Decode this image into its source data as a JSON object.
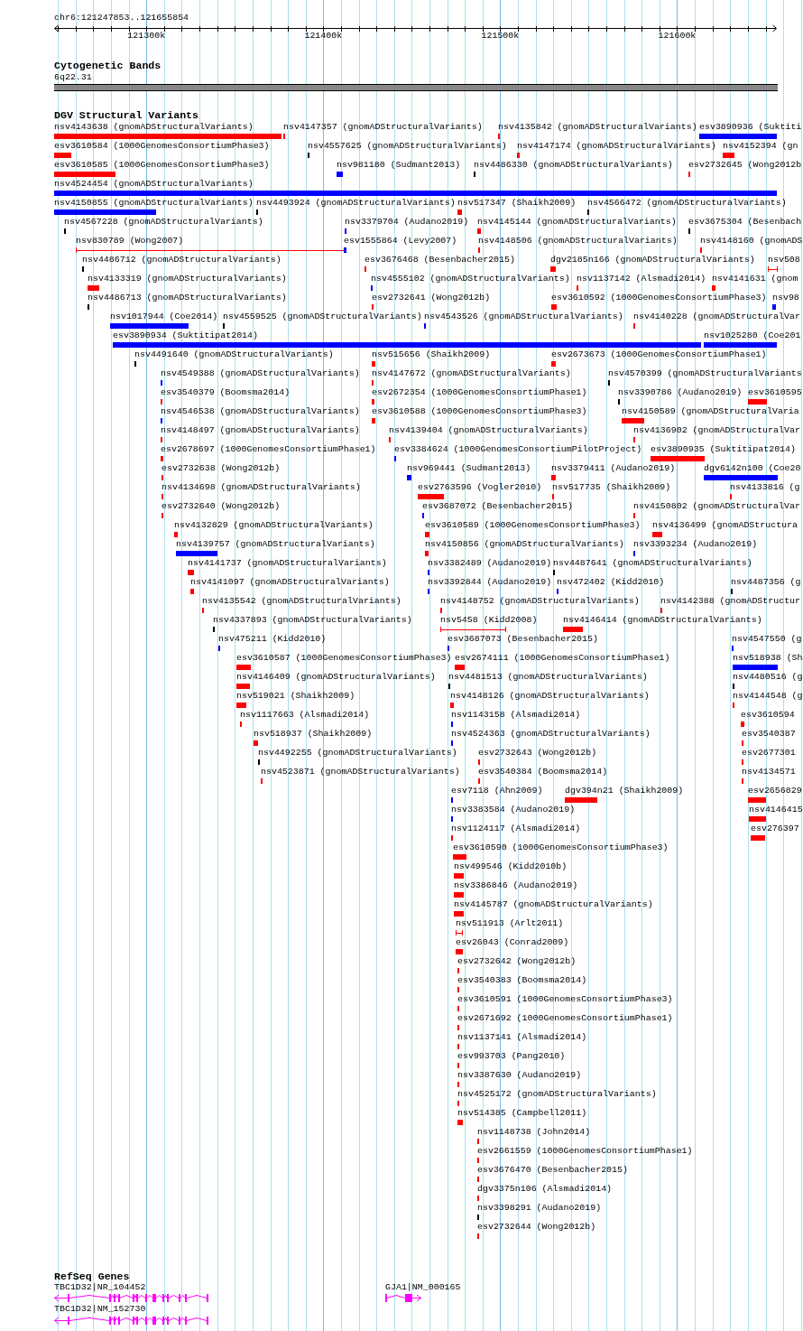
{
  "locus": {
    "position": "chr6:121247853..121655854",
    "ticks": [
      "121300k",
      "121400k",
      "121500k",
      "121600k"
    ]
  },
  "cytogenetic_bands": {
    "title": "Cytogenetic Bands",
    "bands": [
      {
        "label": "6q22.31"
      }
    ]
  },
  "dgv_track": {
    "title": "DGV Structural Variants",
    "variants": [
      {
        "label": "nsv4143638 (gnomADStructuralVariants)",
        "color": "#ff0000",
        "kind": "bar"
      },
      {
        "label": "nsv4147357 (gnomADStructuralVariants)",
        "color": "#ff0000",
        "kind": "bar"
      },
      {
        "label": "nsv4135842 (gnomADStructuralVariants)",
        "color": "#ff0000",
        "kind": "bar"
      },
      {
        "label": "esv3890936 (Suktiti",
        "color": "#0000ff",
        "kind": "bar"
      },
      {
        "label": "esv3610584 (1000GenomesConsortiumPhase3)",
        "color": "#ff0000",
        "kind": "bar"
      },
      {
        "label": "nsv4557625 (gnomADStructuralVariants)",
        "color": "#000000",
        "kind": "bar"
      },
      {
        "label": "nsv4147174 (gnomADStructuralVariants)",
        "color": "#ff0000",
        "kind": "bar"
      },
      {
        "label": "nsv4152394 (gn",
        "color": "#ff0000",
        "kind": "bar"
      },
      {
        "label": "esv3610585 (1000GenomesConsortiumPhase3)",
        "color": "#ff0000",
        "kind": "bar"
      },
      {
        "label": "nsv981180 (Sudmant2013)",
        "color": "#0000ff",
        "kind": "bar"
      },
      {
        "label": "nsv4486330 (gnomADStructuralVariants)",
        "color": "#000000",
        "kind": "bar"
      },
      {
        "label": "esv2732645 (Wong2012b",
        "color": "#ff0000",
        "kind": "bar"
      },
      {
        "label": "nsv4524454 (gnomADStructuralVariants)",
        "color": "#0000ff",
        "kind": "bar"
      },
      {
        "label": "nsv4150855 (gnomADStructuralVariants)",
        "color": "#0000ff",
        "kind": "bar"
      },
      {
        "label": "nsv4493924 (gnomADStructuralVariants)",
        "color": "#000000",
        "kind": "bar"
      },
      {
        "label": "nsv517347 (Shaikh2009)",
        "color": "#ff0000",
        "kind": "bar"
      },
      {
        "label": "nsv4566472 (gnomADStructuralVariants)",
        "color": "#000000",
        "kind": "bar"
      },
      {
        "label": "nsv4567228 (gnomADStructuralVariants)",
        "color": "#000000",
        "kind": "bar"
      },
      {
        "label": "nsv3379704 (Audano2019)",
        "color": "#0000ff",
        "kind": "bar"
      },
      {
        "label": "nsv4145144 (gnomADStructuralVariants)",
        "color": "#ff0000",
        "kind": "bar"
      },
      {
        "label": "esv3675304 (Besenbach",
        "color": "#000000",
        "kind": "bar"
      },
      {
        "label": "nsv830789 (Wong2007)",
        "color": "#ff0000",
        "kind": "span"
      },
      {
        "label": "esv1555864 (Levy2007)",
        "color": "#0000ff",
        "kind": "bar"
      },
      {
        "label": "nsv4148506 (gnomADStructuralVariants)",
        "color": "#ff0000",
        "kind": "bar"
      },
      {
        "label": "nsv4148160 (gnomADS",
        "color": "#ff0000",
        "kind": "bar"
      },
      {
        "label": "nsv4486712 (gnomADStructuralVariants)",
        "color": "#000000",
        "kind": "bar"
      },
      {
        "label": "esv3676468 (Besenbacher2015)",
        "color": "#ff0000",
        "kind": "bar"
      },
      {
        "label": "dgv2185n166 (gnomADStructuralVariants)",
        "color": "#ff0000",
        "kind": "bar"
      },
      {
        "label": "nsv508",
        "color": "#ff0000",
        "kind": "span"
      },
      {
        "label": "nsv4133319 (gnomADStructuralVariants)",
        "color": "#ff0000",
        "kind": "bar"
      },
      {
        "label": "nsv4555102 (gnomADStructuralVariants)",
        "color": "#0000ff",
        "kind": "bar"
      },
      {
        "label": "nsv1137142 (Alsmadi2014)",
        "color": "#ff0000",
        "kind": "bar"
      },
      {
        "label": "nsv4141631 (gnom",
        "color": "#ff0000",
        "kind": "bar"
      },
      {
        "label": "nsv4486713 (gnomADStructuralVariants)",
        "color": "#000000",
        "kind": "bar"
      },
      {
        "label": "esv2732641 (Wong2012b)",
        "color": "#ff0000",
        "kind": "bar"
      },
      {
        "label": "esv3610592 (1000GenomesConsortiumPhase3)",
        "color": "#ff0000",
        "kind": "bar"
      },
      {
        "label": "nsv98",
        "color": "#0000ff",
        "kind": "bar"
      },
      {
        "label": "nsv1017944 (Coe2014)",
        "color": "#0000ff",
        "kind": "bar"
      },
      {
        "label": "nsv4559525 (gnomADStructuralVariants)",
        "color": "#000000",
        "kind": "bar"
      },
      {
        "label": "nsv4543526 (gnomADStructuralVariants)",
        "color": "#0000ff",
        "kind": "bar"
      },
      {
        "label": "nsv4140228 (gnomADStructuralVar",
        "color": "#ff0000",
        "kind": "bar"
      },
      {
        "label": "esv3890934 (Suktitipat2014)",
        "color": "#0000ff",
        "kind": "bar"
      },
      {
        "label": "nsv1025280 (Coe201",
        "color": "#0000ff",
        "kind": "bar"
      },
      {
        "label": "nsv4491640 (gnomADStructuralVariants)",
        "color": "#000000",
        "kind": "bar"
      },
      {
        "label": "nsv515656 (Shaikh2009)",
        "color": "#ff0000",
        "kind": "bar"
      },
      {
        "label": "esv2673673 (1000GenomesConsortiumPhase1)",
        "color": "#ff0000",
        "kind": "bar"
      },
      {
        "label": "nsv4549388 (gnomADStructuralVariants)",
        "color": "#0000ff",
        "kind": "bar"
      },
      {
        "label": "nsv4147672 (gnomADStructuralVariants)",
        "color": "#ff0000",
        "kind": "bar"
      },
      {
        "label": "nsv4570399 (gnomADStructuralVariants",
        "color": "#000000",
        "kind": "bar"
      },
      {
        "label": "esv3540379 (Boomsma2014)",
        "color": "#ff0000",
        "kind": "bar"
      },
      {
        "label": "esv2672354 (1000GenomesConsortiumPhase1)",
        "color": "#ff0000",
        "kind": "bar"
      },
      {
        "label": "nsv3390786 (Audano2019)",
        "color": "#000000",
        "kind": "bar"
      },
      {
        "label": "esv3610595",
        "color": "#ff0000",
        "kind": "bar"
      },
      {
        "label": "nsv4546538 (gnomADStructuralVariants)",
        "color": "#0000ff",
        "kind": "bar"
      },
      {
        "label": "esv3610588 (1000GenomesConsortiumPhase3)",
        "color": "#ff0000",
        "kind": "bar"
      },
      {
        "label": "nsv4150589 (gnomADStructuralVaria",
        "color": "#ff0000",
        "kind": "bar"
      },
      {
        "label": "nsv4148497 (gnomADStructuralVariants)",
        "color": "#ff0000",
        "kind": "bar"
      },
      {
        "label": "nsv4139404 (gnomADStructuralVariants)",
        "color": "#ff0000",
        "kind": "bar"
      },
      {
        "label": "nsv4136902 (gnomADStructuralVar",
        "color": "#ff0000",
        "kind": "bar"
      },
      {
        "label": "esv2678697 (1000GenomesConsortiumPhase1)",
        "color": "#ff0000",
        "kind": "bar"
      },
      {
        "label": "esv3384624 (1000GenomesConsortiumPilotProject)",
        "color": "#0000ff",
        "kind": "bar"
      },
      {
        "label": "esv3890935 (Suktitipat2014)",
        "color": "#ff0000",
        "kind": "bar"
      },
      {
        "label": "esv2732638 (Wong2012b)",
        "color": "#ff0000",
        "kind": "bar"
      },
      {
        "label": "nsv969441 (Sudmant2013)",
        "color": "#0000ff",
        "kind": "bar"
      },
      {
        "label": "nsv3379411 (Audano2019)",
        "color": "#ff0000",
        "kind": "bar"
      },
      {
        "label": "dgv6142n100 (Coe20",
        "color": "#0000ff",
        "kind": "bar"
      },
      {
        "label": "nsv4134698 (gnomADStructuralVariants)",
        "color": "#ff0000",
        "kind": "bar"
      },
      {
        "label": "esv2763596 (Vogler2010)",
        "color": "#ff0000",
        "kind": "bar"
      },
      {
        "label": "nsv517735 (Shaikh2009)",
        "color": "#ff0000",
        "kind": "bar"
      },
      {
        "label": "nsv4133816 (g",
        "color": "#ff0000",
        "kind": "bar"
      },
      {
        "label": "esv2732640 (Wong2012b)",
        "color": "#ff0000",
        "kind": "bar"
      },
      {
        "label": "esv3687072 (Besenbacher2015)",
        "color": "#0000ff",
        "kind": "bar"
      },
      {
        "label": "nsv4150802 (gnomADStructuralVar",
        "color": "#ff0000",
        "kind": "bar"
      },
      {
        "label": "nsv4132829 (gnomADStructuralVariants)",
        "color": "#ff0000",
        "kind": "bar"
      },
      {
        "label": "esv3610589 (1000GenomesConsortiumPhase3)",
        "color": "#ff0000",
        "kind": "bar"
      },
      {
        "label": "nsv4136499 (gnomADStructura",
        "color": "#ff0000",
        "kind": "bar"
      },
      {
        "label": "nsv4139757 (gnomADStructuralVariants)",
        "color": "#0000ff",
        "kind": "bar"
      },
      {
        "label": "nsv4150856 (gnomADStructuralVariants)",
        "color": "#ff0000",
        "kind": "bar"
      },
      {
        "label": "nsv3393234 (Audano2019)",
        "color": "#0000ff",
        "kind": "bar"
      },
      {
        "label": "nsv4141737 (gnomADStructuralVariants)",
        "color": "#ff0000",
        "kind": "bar"
      },
      {
        "label": "nsv3382489 (Audano2019)",
        "color": "#0000ff",
        "kind": "bar"
      },
      {
        "label": "nsv4487641 (gnomADStructuralVariants)",
        "color": "#000000",
        "kind": "bar"
      },
      {
        "label": "nsv4141097 (gnomADStructuralVariants)",
        "color": "#ff0000",
        "kind": "bar"
      },
      {
        "label": "nsv3392844 (Audano2019)",
        "color": "#0000ff",
        "kind": "bar"
      },
      {
        "label": "nsv472402 (Kidd2010)",
        "color": "#0000ff",
        "kind": "bar"
      },
      {
        "label": "nsv4487356 (g",
        "color": "#000000",
        "kind": "bar"
      },
      {
        "label": "nsv4135542 (gnomADStructuralVariants)",
        "color": "#ff0000",
        "kind": "bar"
      },
      {
        "label": "nsv4148752 (gnomADStructuralVariants)",
        "color": "#ff0000",
        "kind": "bar"
      },
      {
        "label": "nsv4142388 (gnomADStructur",
        "color": "#ff0000",
        "kind": "bar"
      },
      {
        "label": "nsv4337893 (gnomADStructuralVariants)",
        "color": "#000000",
        "kind": "bar"
      },
      {
        "label": "nsv5458 (Kidd2008)",
        "color": "#ff0000",
        "kind": "span"
      },
      {
        "label": "nsv4146414 (gnomADStructuralVariants)",
        "color": "#ff0000",
        "kind": "bar"
      },
      {
        "label": "nsv475211 (Kidd2010)",
        "color": "#0000ff",
        "kind": "bar"
      },
      {
        "label": "esv3687073 (Besenbacher2015)",
        "color": "#0000ff",
        "kind": "bar"
      },
      {
        "label": "nsv4547550 (g",
        "color": "#0000ff",
        "kind": "bar"
      },
      {
        "label": "esv3610587 (1000GenomesConsortiumPhase3)",
        "color": "#ff0000",
        "kind": "bar"
      },
      {
        "label": "esv2674111 (1000GenomesConsortiumPhase1)",
        "color": "#ff0000",
        "kind": "bar"
      },
      {
        "label": "nsv518938 (Sh",
        "color": "#0000ff",
        "kind": "bar"
      },
      {
        "label": "nsv4146409 (gnomADStructuralVariants)",
        "color": "#ff0000",
        "kind": "bar"
      },
      {
        "label": "nsv4481513 (gnomADStructuralVariants)",
        "color": "#000000",
        "kind": "bar"
      },
      {
        "label": "nsv4480516 (g",
        "color": "#000000",
        "kind": "bar"
      },
      {
        "label": "nsv519021 (Shaikh2009)",
        "color": "#ff0000",
        "kind": "bar"
      },
      {
        "label": "nsv4148126 (gnomADStructuralVariants)",
        "color": "#ff0000",
        "kind": "bar"
      },
      {
        "label": "nsv4144548 (g",
        "color": "#ff0000",
        "kind": "bar"
      },
      {
        "label": "nsv1117663 (Alsmadi2014)",
        "color": "#ff0000",
        "kind": "bar"
      },
      {
        "label": "nsv1143158 (Alsmadi2014)",
        "color": "#0000ff",
        "kind": "bar"
      },
      {
        "label": "esv3610594",
        "color": "#ff0000",
        "kind": "bar"
      },
      {
        "label": "nsv518937 (Shaikh2009)",
        "color": "#ff0000",
        "kind": "bar"
      },
      {
        "label": "nsv4524363 (gnomADStructuralVariants)",
        "color": "#0000ff",
        "kind": "bar"
      },
      {
        "label": "esv3540387",
        "color": "#ff0000",
        "kind": "bar"
      },
      {
        "label": "nsv4492255 (gnomADStructuralVariants)",
        "color": "#000000",
        "kind": "bar"
      },
      {
        "label": "esv2732643 (Wong2012b)",
        "color": "#ff0000",
        "kind": "bar"
      },
      {
        "label": "esv2677301",
        "color": "#ff0000",
        "kind": "bar"
      },
      {
        "label": "nsv4523871 (gnomADStructuralVariants)",
        "color": "#ff0000",
        "kind": "bar"
      },
      {
        "label": "esv3540384 (Boomsma2014)",
        "color": "#ff0000",
        "kind": "bar"
      },
      {
        "label": "nsv4134571",
        "color": "#ff0000",
        "kind": "bar"
      },
      {
        "label": "esv7118 (Ahn2009)",
        "color": "#0000ff",
        "kind": "bar"
      },
      {
        "label": "dgv394n21 (Shaikh2009)",
        "color": "#ff0000",
        "kind": "bar"
      },
      {
        "label": "esv2656829",
        "color": "#ff0000",
        "kind": "bar"
      },
      {
        "label": "nsv3383584 (Audano2019)",
        "color": "#0000ff",
        "kind": "bar"
      },
      {
        "label": "nsv4146415",
        "color": "#ff0000",
        "kind": "bar"
      },
      {
        "label": "nsv1124117 (Alsmadi2014)",
        "color": "#ff0000",
        "kind": "bar"
      },
      {
        "label": "esv276397",
        "color": "#ff0000",
        "kind": "bar"
      },
      {
        "label": "esv3610590 (1000GenomesConsortiumPhase3)",
        "color": "#ff0000",
        "kind": "bar"
      },
      {
        "label": "nsv499546 (Kidd2010b)",
        "color": "#ff0000",
        "kind": "bar"
      },
      {
        "label": "nsv3386846 (Audano2019)",
        "color": "#ff0000",
        "kind": "bar"
      },
      {
        "label": "nsv4145787 (gnomADStructuralVariants)",
        "color": "#ff0000",
        "kind": "bar"
      },
      {
        "label": "nsv511913 (Arlt2011)",
        "color": "#ff0000",
        "kind": "span"
      },
      {
        "label": "esv26043 (Conrad2009)",
        "color": "#ff0000",
        "kind": "bar"
      },
      {
        "label": "esv2732642 (Wong2012b)",
        "color": "#ff0000",
        "kind": "bar"
      },
      {
        "label": "esv3540383 (Boomsma2014)",
        "color": "#ff0000",
        "kind": "bar"
      },
      {
        "label": "esv3610591 (1000GenomesConsortiumPhase3)",
        "color": "#ff0000",
        "kind": "bar"
      },
      {
        "label": "esv2671692 (1000GenomesConsortiumPhase1)",
        "color": "#ff0000",
        "kind": "bar"
      },
      {
        "label": "nsv1137141 (Alsmadi2014)",
        "color": "#ff0000",
        "kind": "bar"
      },
      {
        "label": "esv993703 (Pang2010)",
        "color": "#ff0000",
        "kind": "bar"
      },
      {
        "label": "nsv3387630 (Audano2019)",
        "color": "#ff0000",
        "kind": "bar"
      },
      {
        "label": "nsv4525172 (gnomADStructuralVariants)",
        "color": "#ff0000",
        "kind": "bar"
      },
      {
        "label": "nsv514385 (Campbell2011)",
        "color": "#ff0000",
        "kind": "bar"
      },
      {
        "label": "nsv1148738 (John2014)",
        "color": "#ff0000",
        "kind": "bar"
      },
      {
        "label": "esv2661559 (1000GenomesConsortiumPhase1)",
        "color": "#ff0000",
        "kind": "bar"
      },
      {
        "label": "esv3676470 (Besenbacher2015)",
        "color": "#ff0000",
        "kind": "bar"
      },
      {
        "label": "dgv3375n106 (Alsmadi2014)",
        "color": "#ff0000",
        "kind": "bar"
      },
      {
        "label": "nsv3398291 (Audano2019)",
        "color": "#000000",
        "kind": "bar"
      },
      {
        "label": "esv2732644 (Wong2012b)",
        "color": "#ff0000",
        "kind": "bar"
      }
    ]
  },
  "refseq_genes": {
    "title": "RefSeq Genes",
    "genes": [
      {
        "label": "TBC1D32|NR_104452",
        "reverse_strand": true
      },
      {
        "label": "GJA1|NM_000165",
        "reverse_strand": false
      },
      {
        "label": "TBC1D32|NM_152730",
        "reverse_strand": true
      }
    ]
  }
}
